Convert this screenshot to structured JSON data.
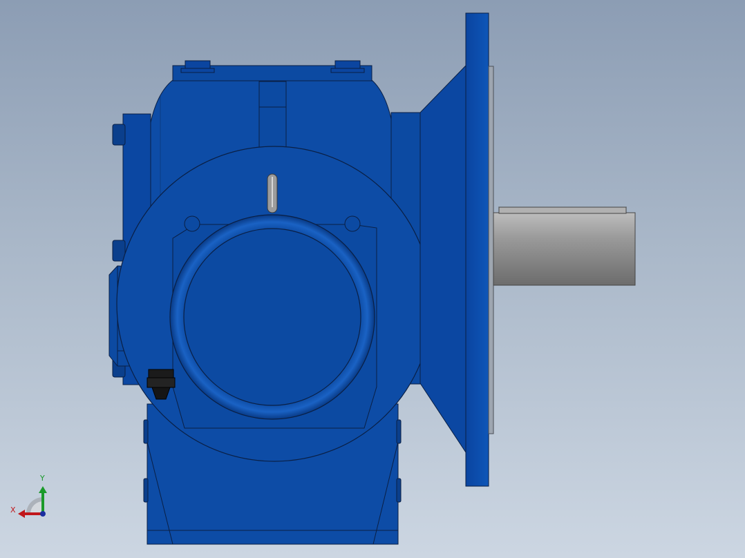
{
  "viewport": {
    "background_top": "#8c9db4",
    "background_bottom": "#ccd6e2"
  },
  "model": {
    "body_color": "#0e4ea6",
    "body_dark": "#083b85",
    "outline": "#0a1f44",
    "shaft_color": "#8e8e8e",
    "icons": [
      "gear-reducer-model",
      "motor-flange",
      "output-shaft",
      "breather-plug",
      "cable-gland"
    ]
  },
  "triad": {
    "x_label": "X",
    "y_label": "Y",
    "x_color": "#c0161b",
    "y_color": "#1a9a2a",
    "icons": [
      "coordinate-triad-icon"
    ]
  }
}
